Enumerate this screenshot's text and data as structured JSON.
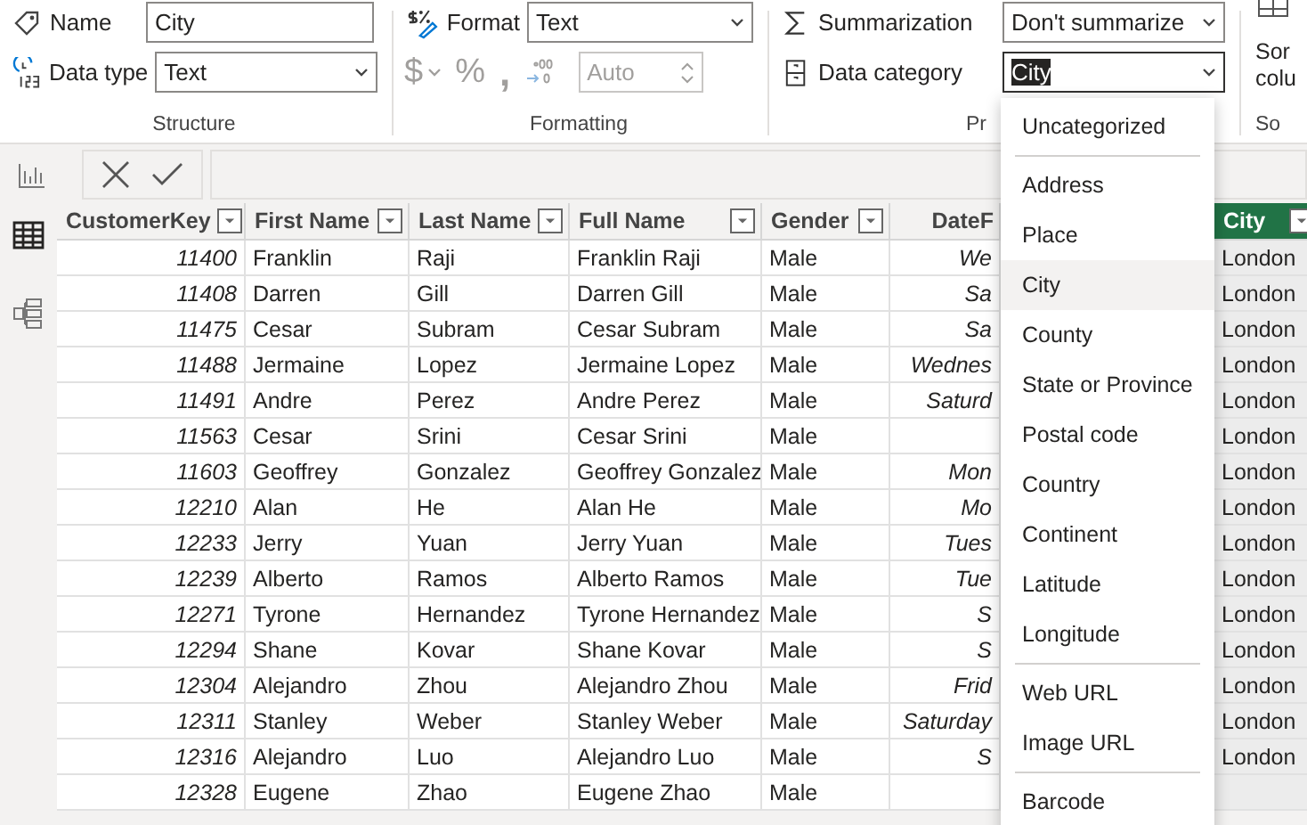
{
  "ribbon": {
    "structure": {
      "name_label": "Name",
      "name_value": "City",
      "datatype_label": "Data type",
      "datatype_value": "Text",
      "group_label": "Structure"
    },
    "formatting": {
      "format_label": "Format",
      "format_value": "Text",
      "disabled": true,
      "buttons": [
        {
          "kind": "text",
          "label": "$"
        },
        {
          "kind": "caret"
        },
        {
          "kind": "text",
          "label": "%"
        },
        {
          "kind": "text",
          "label": ","
        },
        {
          "kind": "decimals"
        }
      ],
      "auto_value": "Auto",
      "group_label": "Formatting"
    },
    "properties": {
      "summarization_label": "Summarization",
      "summarization_value": "Don't summarize",
      "category_label": "Data category",
      "category_value": "City",
      "category_text_selected": true,
      "group_label": "Pr"
    },
    "sort": {
      "button_lines": [
        "Sor",
        "colu"
      ],
      "group_label": "So"
    }
  },
  "views": [
    {
      "selected": false
    },
    {
      "selected": true
    },
    {
      "selected": false
    }
  ],
  "table": {
    "columns": [
      {
        "label": "CustomerKey",
        "selected": false
      },
      {
        "label": "First Name",
        "selected": false
      },
      {
        "label": "Last Name",
        "selected": false
      },
      {
        "label": "Full Name",
        "selected": false
      },
      {
        "label": "Gender",
        "selected": false
      },
      {
        "label": "DateF",
        "selected": false
      },
      {
        "label": "City",
        "selected": true
      }
    ],
    "rows": [
      {
        "cells": [
          "11400",
          "Franklin",
          "Raji",
          "Franklin Raji",
          "Male",
          "We",
          "London"
        ]
      },
      {
        "cells": [
          "11408",
          "Darren",
          "Gill",
          "Darren Gill",
          "Male",
          "Sa",
          "London"
        ]
      },
      {
        "cells": [
          "11475",
          "Cesar",
          "Subram",
          "Cesar Subram",
          "Male",
          "Sa",
          "London"
        ]
      },
      {
        "cells": [
          "11488",
          "Jermaine",
          "Lopez",
          "Jermaine Lopez",
          "Male",
          "Wednes",
          "London"
        ]
      },
      {
        "cells": [
          "11491",
          "Andre",
          "Perez",
          "Andre Perez",
          "Male",
          "Saturd",
          "London"
        ]
      },
      {
        "cells": [
          "11563",
          "Cesar",
          "Srini",
          "Cesar Srini",
          "Male",
          null,
          "London"
        ]
      },
      {
        "cells": [
          "11603",
          "Geoffrey",
          "Gonzalez",
          "Geoffrey Gonzalez",
          "Male",
          "Mon",
          "London"
        ]
      },
      {
        "cells": [
          "12210",
          "Alan",
          "He",
          "Alan He",
          "Male",
          "Mo",
          "London"
        ]
      },
      {
        "cells": [
          "12233",
          "Jerry",
          "Yuan",
          "Jerry Yuan",
          "Male",
          "Tues",
          "London"
        ]
      },
      {
        "cells": [
          "12239",
          "Alberto",
          "Ramos",
          "Alberto Ramos",
          "Male",
          "Tue",
          "London"
        ]
      },
      {
        "cells": [
          "12271",
          "Tyrone",
          "Hernandez",
          "Tyrone Hernandez",
          "Male",
          "S",
          "London"
        ]
      },
      {
        "cells": [
          "12294",
          "Shane",
          "Kovar",
          "Shane Kovar",
          "Male",
          "S",
          "London"
        ]
      },
      {
        "cells": [
          "12304",
          "Alejandro",
          "Zhou",
          "Alejandro Zhou",
          "Male",
          "Frid",
          "London"
        ]
      },
      {
        "cells": [
          "12311",
          "Stanley",
          "Weber",
          "Stanley Weber",
          "Male",
          "Saturday",
          "London"
        ]
      },
      {
        "cells": [
          "12316",
          "Alejandro",
          "Luo",
          "Alejandro Luo",
          "Male",
          "S",
          "London"
        ]
      },
      {
        "cells": [
          "12328",
          "Eugene",
          "Zhao",
          "Eugene Zhao",
          "Male",
          null,
          null
        ]
      }
    ]
  },
  "category_menu": {
    "groups": [
      [
        {
          "label": "Uncategorized",
          "selected": false
        }
      ],
      [
        {
          "label": "Address",
          "selected": false
        },
        {
          "label": "Place",
          "selected": false
        },
        {
          "label": "City",
          "selected": true
        },
        {
          "label": "County",
          "selected": false
        },
        {
          "label": "State or Province",
          "selected": false
        },
        {
          "label": "Postal code",
          "selected": false
        },
        {
          "label": "Country",
          "selected": false
        },
        {
          "label": "Continent",
          "selected": false
        },
        {
          "label": "Latitude",
          "selected": false
        },
        {
          "label": "Longitude",
          "selected": false
        }
      ],
      [
        {
          "label": "Web URL",
          "selected": false
        },
        {
          "label": "Image URL",
          "selected": false
        }
      ],
      [
        {
          "label": "Barcode",
          "selected": false
        }
      ]
    ]
  }
}
